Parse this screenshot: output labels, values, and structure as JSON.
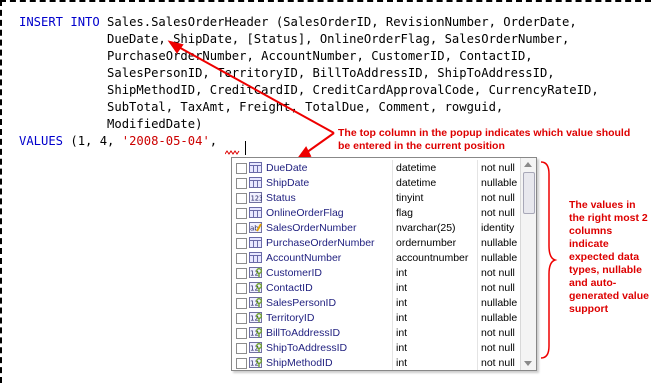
{
  "code": {
    "lines": [
      {
        "kw": "INSERT INTO",
        "text": " Sales.SalesOrderHeader (SalesOrderID, RevisionNumber, OrderDate,"
      },
      {
        "kw": "",
        "text": "            DueDate, ShipDate, [Status], OnlineOrderFlag, SalesOrderNumber,"
      },
      {
        "kw": "",
        "text": "            PurchaseOrderNumber, AccountNumber, CustomerID, ContactID,"
      },
      {
        "kw": "",
        "text": "            SalesPersonID, TerritoryID, BillToAddressID, ShipToAddressID,"
      },
      {
        "kw": "",
        "text": "            ShipMethodID, CreditCardID, CreditCardApprovalCode, CurrencyRateID,"
      },
      {
        "kw": "",
        "text": "            SubTotal, TaxAmt, Freight, TotalDue, Comment, rowguid,"
      },
      {
        "kw": "",
        "text": "            ModifiedDate)"
      }
    ],
    "values_line": {
      "kw": "VALUES",
      "pre": " (1, 4, ",
      "str": "'2008-05-04'",
      "post": ","
    }
  },
  "annotations": {
    "top_note": "The top column in the popup indicates which value should be entered in the current position",
    "right_note": "The values in the right most 2 columns indicate expected data types, nullable and auto-generated value support"
  },
  "popup": {
    "rows": [
      {
        "name": "DueDate",
        "type": "datetime",
        "null": "not null",
        "icon": "column-icon"
      },
      {
        "name": "ShipDate",
        "type": "datetime",
        "null": "nullable",
        "icon": "column-icon"
      },
      {
        "name": "Status",
        "type": "tinyint",
        "null": "not null",
        "icon": "numeric-column-icon"
      },
      {
        "name": "OnlineOrderFlag",
        "type": "flag",
        "null": "not null",
        "icon": "column-icon"
      },
      {
        "name": "SalesOrderNumber",
        "type": "nvarchar(25)",
        "null": "identity",
        "icon": "computed-column-icon"
      },
      {
        "name": "PurchaseOrderNumber",
        "type": "ordernumber",
        "null": "nullable",
        "icon": "column-icon"
      },
      {
        "name": "AccountNumber",
        "type": "accountnumber",
        "null": "nullable",
        "icon": "column-icon"
      },
      {
        "name": "CustomerID",
        "type": "int",
        "null": "not null",
        "icon": "key-column-icon"
      },
      {
        "name": "ContactID",
        "type": "int",
        "null": "not null",
        "icon": "key-column-icon"
      },
      {
        "name": "SalesPersonID",
        "type": "int",
        "null": "nullable",
        "icon": "key-column-icon"
      },
      {
        "name": "TerritoryID",
        "type": "int",
        "null": "nullable",
        "icon": "key-column-icon"
      },
      {
        "name": "BillToAddressID",
        "type": "int",
        "null": "not null",
        "icon": "key-column-icon"
      },
      {
        "name": "ShipToAddressID",
        "type": "int",
        "null": "not null",
        "icon": "key-column-icon"
      },
      {
        "name": "ShipMethodID",
        "type": "int",
        "null": "not null",
        "icon": "key-column-icon"
      }
    ]
  },
  "colors": {
    "keyword": "#0000cc",
    "string": "#cc0000",
    "annotation": "#dd0000"
  }
}
